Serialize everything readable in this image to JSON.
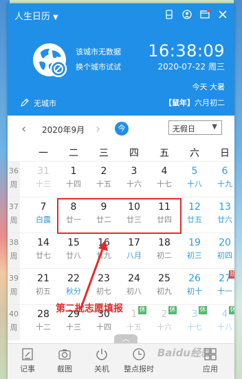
{
  "header": {
    "title": "人生日历",
    "city_line1": "该城市无数据",
    "city_line2": "换个城市试试",
    "time": "16:38:09",
    "date": "2020-07-22 周三",
    "today": "今天 大暑",
    "no_city": "无城市",
    "lunar_year": "【鼠年】",
    "lunar_day": "六月初二"
  },
  "nav": {
    "month": "2020年9月",
    "today_btn": "今",
    "holiday_select": "无假日"
  },
  "weekdays": [
    "一",
    "二",
    "三",
    "四",
    "五",
    "六",
    "日"
  ],
  "weeks": [
    {
      "num": "36\n周",
      "days": [
        {
          "d": "31",
          "l": "十三",
          "dim": true
        },
        {
          "d": "1",
          "l": "十四"
        },
        {
          "d": "2",
          "l": "十五"
        },
        {
          "d": "3",
          "l": "十六"
        },
        {
          "d": "4",
          "l": "十七"
        },
        {
          "d": "5",
          "l": "十八",
          "we": true
        },
        {
          "d": "6",
          "l": "十九",
          "we": true
        }
      ]
    },
    {
      "num": "37\n周",
      "days": [
        {
          "d": "7",
          "l": "白露",
          "term": true
        },
        {
          "d": "8",
          "l": "廿一"
        },
        {
          "d": "9",
          "l": "廿二"
        },
        {
          "d": "10",
          "l": "廿三"
        },
        {
          "d": "11",
          "l": "廿四"
        },
        {
          "d": "12",
          "l": "廿五",
          "we": true
        },
        {
          "d": "13",
          "l": "廿六",
          "we": true
        }
      ]
    },
    {
      "num": "38\n周",
      "days": [
        {
          "d": "14",
          "l": "廿七"
        },
        {
          "d": "15",
          "l": "廿八"
        },
        {
          "d": "16",
          "l": "廿九"
        },
        {
          "d": "17",
          "l": "八月",
          "term": true
        },
        {
          "d": "18",
          "l": "初二"
        },
        {
          "d": "19",
          "l": "初三",
          "we": true
        },
        {
          "d": "20",
          "l": "初四",
          "we": true
        }
      ]
    },
    {
      "num": "39\n周",
      "days": [
        {
          "d": "21",
          "l": "初五"
        },
        {
          "d": "22",
          "l": "秋分",
          "term": true
        },
        {
          "d": "23",
          "l": "初七"
        },
        {
          "d": "24",
          "l": "初八"
        },
        {
          "d": "25",
          "l": "初九"
        },
        {
          "d": "26",
          "l": "初十",
          "we": true
        },
        {
          "d": "27",
          "l": "十一",
          "we": true,
          "badge": "班",
          "badge_color": "red"
        }
      ]
    },
    {
      "num": "40\n周",
      "days": [
        {
          "d": "28",
          "l": "十二"
        },
        {
          "d": "29",
          "l": "十三"
        },
        {
          "d": "30",
          "l": "十四"
        },
        {
          "d": "1",
          "l": "十五",
          "dim": true,
          "badge": "休",
          "badge_color": "green"
        },
        {
          "d": "2",
          "l": "十六",
          "dim": true,
          "badge": "休",
          "badge_color": "green"
        },
        {
          "d": "3",
          "l": "十七",
          "dim": true,
          "we": true,
          "badge": "休",
          "badge_color": "green"
        },
        {
          "d": "4",
          "l": "十八",
          "dim": true,
          "we": true,
          "badge": "休",
          "badge_color": "green"
        }
      ]
    }
  ],
  "annotation": "第二批志愿填报",
  "bottom": {
    "items": [
      {
        "label": "记事",
        "icon": "note-icon"
      },
      {
        "label": "截图",
        "icon": "camera-icon"
      },
      {
        "label": "关机",
        "icon": "power-icon"
      },
      {
        "label": "整点报时",
        "icon": "clock-icon"
      },
      {
        "label": "应用",
        "icon": "apps-icon"
      }
    ]
  },
  "watermark": "Baidu经验",
  "colors": {
    "accent": "#1f8fe8",
    "weekend": "#2f9be0",
    "highlight": "#e32a2a"
  }
}
